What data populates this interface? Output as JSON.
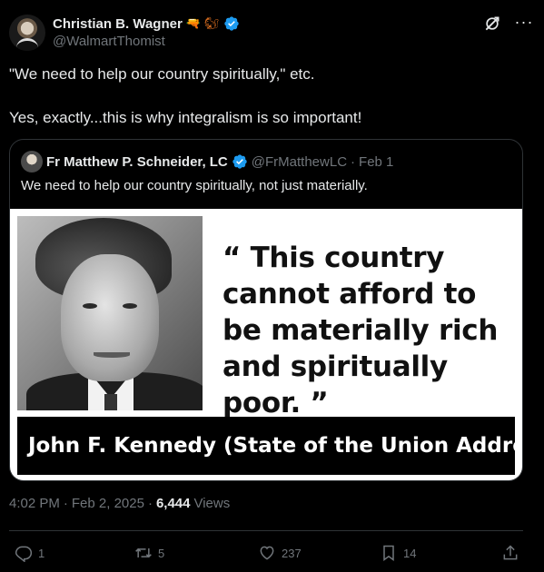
{
  "author": {
    "display_name": "Christian B. Wagner",
    "emoji_1": "🔫",
    "emoji_2": "🐿",
    "handle": "@WalmartThomist",
    "verified": true
  },
  "tweet": {
    "line_1": "\"We need to help our country spiritually,\" etc.",
    "line_2": "Yes, exactly...this is why integralism is so important!"
  },
  "quoted": {
    "name": "Fr Matthew P. Schneider, LC",
    "handle": "@FrMatthewLC",
    "separator": "·",
    "date": "Feb 1",
    "text": "We need to help our country spiritually, not just materially.",
    "image": {
      "quote": "“ This country cannot afford to be materially rich and spiritually poor. ”",
      "attribution": "John F. Kennedy  (State of the Union Address)"
    }
  },
  "meta": {
    "time": "4:02 PM",
    "sep1": "·",
    "date": "Feb 2, 2025",
    "sep2": "·",
    "views_count": "6,444",
    "views_label": "Views"
  },
  "actions": {
    "replies": "1",
    "reposts": "5",
    "likes": "237",
    "bookmarks": "14"
  },
  "colors": {
    "background": "#000000",
    "text": "#e7e9ea",
    "secondary": "#71767b",
    "verified": "#1d9bf0",
    "border": "#2f3336"
  },
  "icons": [
    "grok-icon",
    "more-icon",
    "verified-badge-icon",
    "reply-icon",
    "repost-icon",
    "like-icon",
    "bookmark-icon",
    "share-icon"
  ]
}
